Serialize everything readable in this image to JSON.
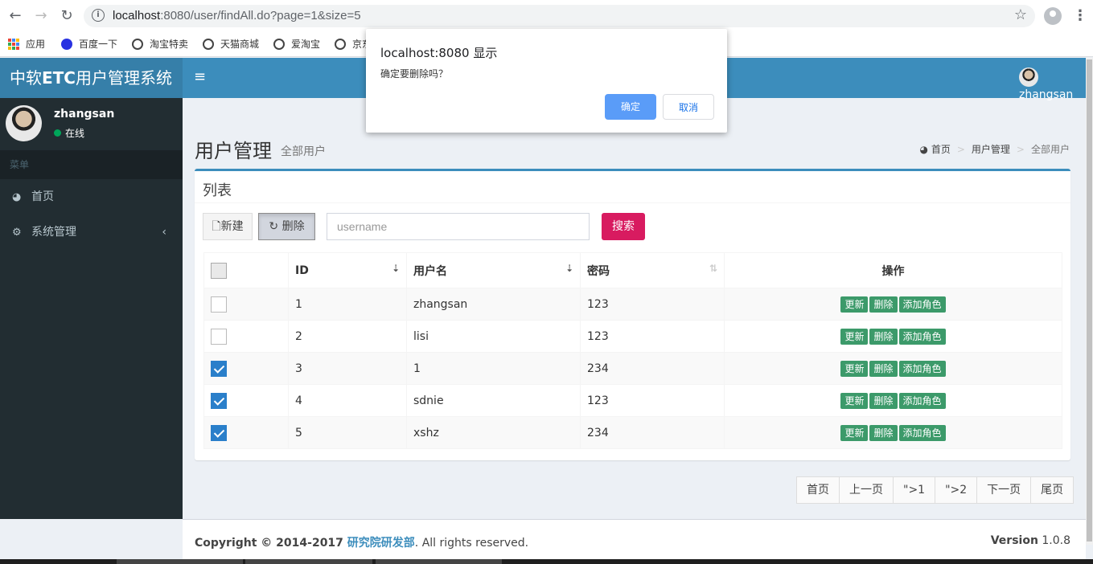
{
  "browser": {
    "url_host": "localhost",
    "url_rest": ":8080/user/findAll.do?page=1&size=5",
    "bookmarks": [
      "应用",
      "百度一下",
      "淘宝特卖",
      "天猫商城",
      "爱淘宝",
      "京东"
    ]
  },
  "dialog": {
    "title": "localhost:8080 显示",
    "message": "确定要删除吗？",
    "ok_label": "确定",
    "cancel_label": "取消"
  },
  "sidebar": {
    "logo_prefix": "中软",
    "logo_bold": "ETC",
    "logo_suffix": "用户管理系统",
    "user_name": "zhangsan",
    "user_status": "在线",
    "menu_header": "菜单",
    "items": [
      {
        "label": "首页",
        "icon": "dashboard-icon"
      },
      {
        "label": "系统管理",
        "icon": "gears-icon"
      }
    ]
  },
  "header": {
    "user_name": "zhangsan"
  },
  "content": {
    "title": "用户管理",
    "subtitle": "全部用户",
    "breadcrumb": [
      "首页",
      "用户管理",
      "全部用户"
    ]
  },
  "box": {
    "title": "列表",
    "new_label": "新建",
    "delete_label": "删除",
    "search_placeholder": "username",
    "search_label": "搜索"
  },
  "table": {
    "headers": [
      "ID",
      "用户名",
      "密码",
      "操作"
    ],
    "rows": [
      {
        "id": "1",
        "username": "zhangsan",
        "password": "123",
        "checked": false
      },
      {
        "id": "2",
        "username": "lisi",
        "password": "123",
        "checked": false
      },
      {
        "id": "3",
        "username": "1",
        "password": "234",
        "checked": true
      },
      {
        "id": "4",
        "username": "sdnie",
        "password": "123",
        "checked": true
      },
      {
        "id": "5",
        "username": "xshz",
        "password": "234",
        "checked": true
      }
    ],
    "row_actions": [
      "更新",
      "删除",
      "添加角色"
    ]
  },
  "pagination": [
    "首页",
    "上一页",
    "\">1",
    "\">2",
    "下一页",
    "尾页"
  ],
  "footer": {
    "copyright_prefix": "Copyright © 2014-2017 ",
    "org": "研究院研发部",
    "copyright_suffix": ". All rights reserved.",
    "version_label": "Version",
    "version": "1.0.8"
  },
  "colors": {
    "header": "#3c8dbc",
    "logo": "#367fa9",
    "sidebar": "#222d32",
    "search_button": "#d81b60",
    "action_button": "#3c9a6a",
    "checkbox_checked": "#2a7fca",
    "dialog_ok": "#5a9cf8"
  }
}
